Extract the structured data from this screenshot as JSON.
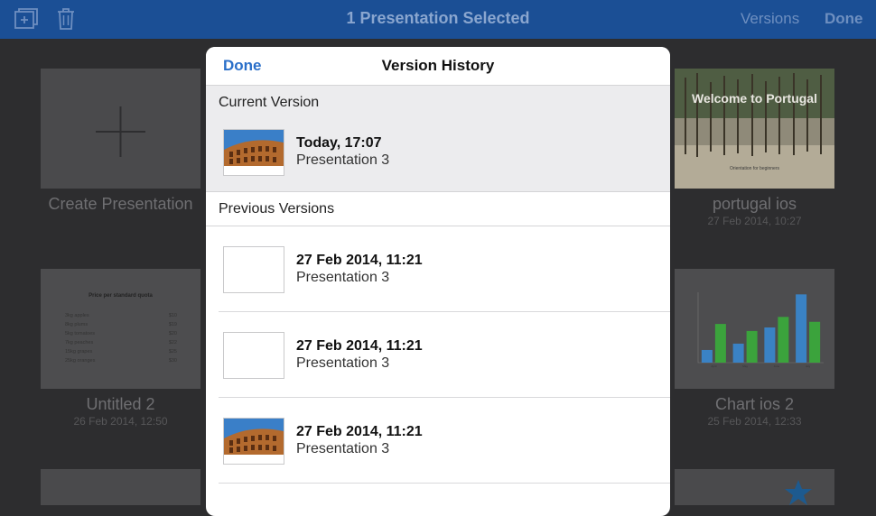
{
  "header": {
    "title": "1 Presentation Selected",
    "versions_label": "Versions",
    "done_label": "Done",
    "icons": [
      "new-presentation-icon",
      "trash-icon"
    ]
  },
  "gallery": {
    "create_label": "Create Presentation",
    "items": [
      {
        "name": "portugal ios",
        "date": "27 Feb 2014, 10:27",
        "slide_title": "Welcome to Portugal",
        "slide_subtitle": "Orientation for beginners"
      },
      {
        "name": "Untitled 2",
        "date": "26 Feb 2014, 12:50"
      },
      {
        "name": "Chart ios 2",
        "date": "25 Feb 2014, 12:33"
      }
    ],
    "table_preview": {
      "title": "Price per standard quota",
      "rows": [
        {
          "item": "3kg apples",
          "price": "$10"
        },
        {
          "item": "8kg plums",
          "price": "$19"
        },
        {
          "item": "5kg tomatoes",
          "price": "$20"
        },
        {
          "item": "7kg peaches",
          "price": "$22"
        },
        {
          "item": "15kg grapes",
          "price": "$25"
        },
        {
          "item": "25kg oranges",
          "price": "$30"
        }
      ]
    },
    "chart_colors": {
      "series1": "#3a82c4",
      "series2": "#3ba33c"
    },
    "chart_data": {
      "type": "bar",
      "categories": [
        "April",
        "May",
        "June",
        "July"
      ],
      "series": [
        {
          "values": [
            18,
            27,
            50,
            97
          ]
        },
        {
          "values": [
            55,
            45,
            65,
            58
          ]
        }
      ],
      "ylim": [
        0,
        100
      ]
    }
  },
  "sheet": {
    "done_label": "Done",
    "title": "Version History",
    "current_section": "Current Version",
    "current": {
      "date": "Today, 17:07",
      "name": "Presentation 3",
      "thumb": "colosseum"
    },
    "previous_section": "Previous Versions",
    "previous": [
      {
        "date": "27 Feb 2014, 11:21",
        "name": "Presentation 3",
        "thumb": "blank"
      },
      {
        "date": "27 Feb 2014, 11:21",
        "name": "Presentation 3",
        "thumb": "blank"
      },
      {
        "date": "27 Feb 2014, 11:21",
        "name": "Presentation 3",
        "thumb": "colosseum"
      }
    ]
  },
  "colors": {
    "nav_bar": "#1b4f95",
    "accent": "#2a6fc9",
    "backdrop": "#2d2d2f"
  }
}
